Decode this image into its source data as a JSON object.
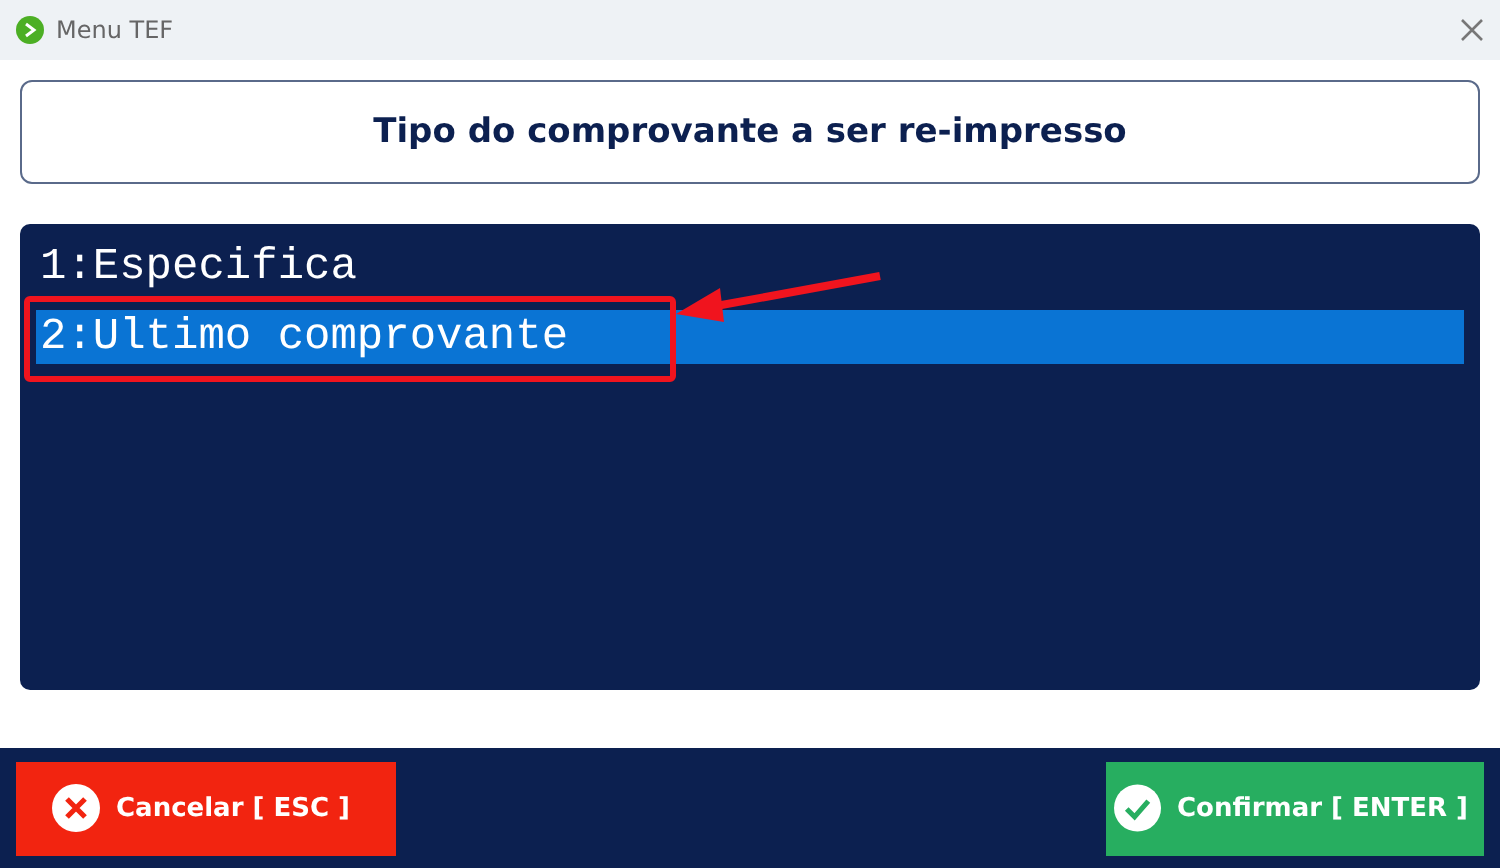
{
  "window": {
    "title": "Menu TEF"
  },
  "header": {
    "title": "Tipo do comprovante a ser re-impresso"
  },
  "options": [
    {
      "label": "1:Especifica",
      "selected": false
    },
    {
      "label": "2:Ultimo comprovante",
      "selected": true
    }
  ],
  "buttons": [
    {
      "kind": "cancel",
      "label": "Cancelar [ ESC ]"
    },
    {
      "kind": "confirm",
      "label": "Confirmar [ ENTER ]"
    }
  ]
}
